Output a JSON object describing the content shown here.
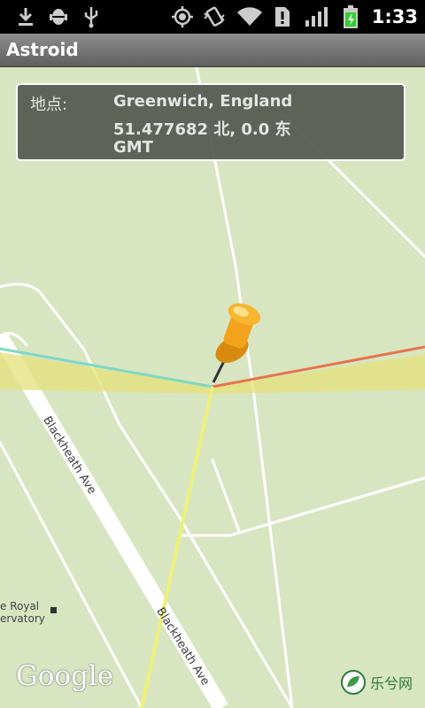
{
  "status_bar": {
    "time": "1:33",
    "icons": [
      "download-icon",
      "android-debug-icon",
      "usb-icon",
      "gps-icon",
      "vibrate-icon",
      "wifi-icon",
      "alert-icon",
      "signal-icon",
      "battery-charging-icon"
    ]
  },
  "app": {
    "title": "Astroid"
  },
  "info_panel": {
    "label": "地点:",
    "place": "Greenwich, England",
    "coords": "51.477682 北, 0.0 东",
    "timezone": "GMT"
  },
  "map": {
    "road_label_1": "Blackheath Ave",
    "road_label_2": "Blackheath Ave",
    "place_label_line1": "e Royal",
    "place_label_line2": "ervatory",
    "attribution": "Google",
    "meridian_colors": {
      "west": "#7fd8c4",
      "east": "#e8734a",
      "south": "#eef07a"
    }
  },
  "watermark": {
    "text": "乐兮网"
  }
}
